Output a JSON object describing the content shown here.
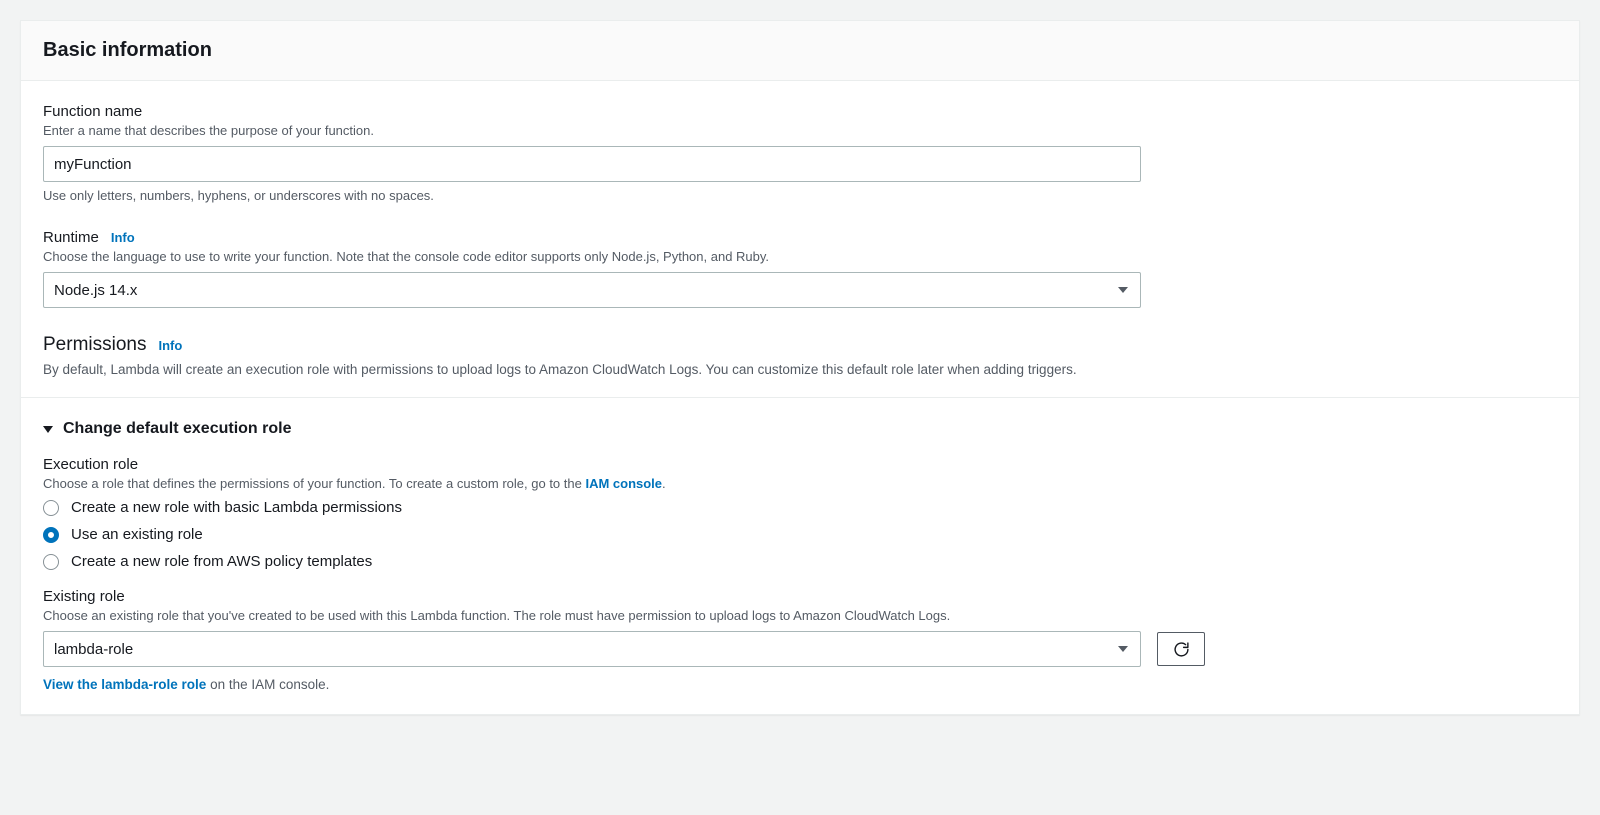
{
  "panel": {
    "title": "Basic information"
  },
  "functionName": {
    "label": "Function name",
    "help": "Enter a name that describes the purpose of your function.",
    "value": "myFunction",
    "hint": "Use only letters, numbers, hyphens, or underscores with no spaces."
  },
  "runtime": {
    "label": "Runtime",
    "info": "Info",
    "help": "Choose the language to use to write your function. Note that the console code editor supports only Node.js, Python, and Ruby.",
    "selected": "Node.js 14.x"
  },
  "permissions": {
    "label": "Permissions",
    "info": "Info",
    "desc": "By default, Lambda will create an execution role with permissions to upload logs to Amazon CloudWatch Logs. You can customize this default role later when adding triggers."
  },
  "expander": {
    "title": "Change default execution role"
  },
  "executionRole": {
    "label": "Execution role",
    "helpPrefix": "Choose a role that defines the permissions of your function. To create a custom role, go to the ",
    "helpLink": "IAM console",
    "helpSuffix": ".",
    "options": [
      "Create a new role with basic Lambda permissions",
      "Use an existing role",
      "Create a new role from AWS policy templates"
    ],
    "selectedIndex": 1
  },
  "existingRole": {
    "label": "Existing role",
    "help": "Choose an existing role that you've created to be used with this Lambda function. The role must have permission to upload logs to Amazon CloudWatch Logs.",
    "selected": "lambda-role",
    "footerLink": "View the lambda-role role",
    "footerSuffix": " on the IAM console."
  }
}
